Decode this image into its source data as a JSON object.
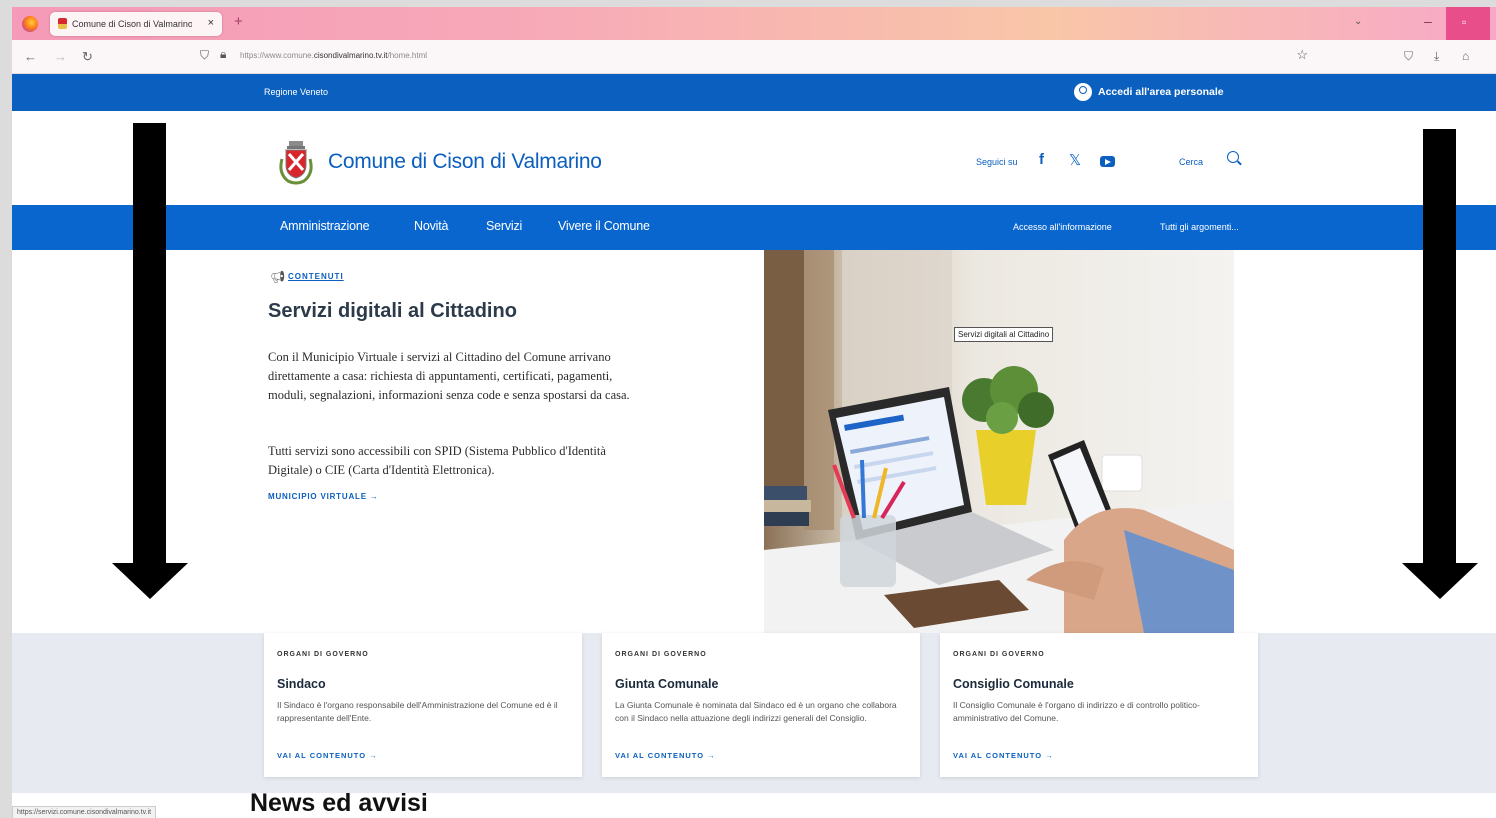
{
  "browser": {
    "tab_title": "Comune di Cison di Valmarino",
    "url_prefix": "https://www.comune.",
    "url_domain": "cisondivalmarino.tv.it",
    "url_path": "/home.html",
    "status_url": "https://servizi.comune.cisondivalmarino.tv.it"
  },
  "header": {
    "region": "Regione Veneto",
    "login": "Accedi all'area personale",
    "site_name": "Comune di Cison di Valmarino",
    "follow": "Seguici su",
    "search": "Cerca"
  },
  "nav": {
    "items": [
      "Amministrazione",
      "Novità",
      "Servizi",
      "Vivere il Comune"
    ],
    "secondary": [
      "Accesso all'informazione",
      "Tutti gli argomenti..."
    ]
  },
  "hero": {
    "category": "CONTENUTI",
    "title": "Servizi digitali al Cittadino",
    "p1": "Con il Municipio Virtuale i servizi al Cittadino del Comune arrivano direttamente a casa: richiesta di appuntamenti, certificati, pagamenti, moduli, segnalazioni, informazioni senza code e senza spostarsi da casa.",
    "p2": "Tutti servizi sono accessibili con SPID (Sistema Pubblico d'Identità Digitale) o CIE (Carta d'Identità Elettronica).",
    "link": "MUNICIPIO VIRTUALE  →",
    "image_tag": "Servizi digitali al Cittadino"
  },
  "cards": [
    {
      "kicker": "ORGANI DI GOVERNO",
      "title": "Sindaco",
      "desc": "Il Sindaco è l'organo responsabile dell'Amministrazione del Comune ed è il rappresentante dell'Ente.",
      "link": "VAI AL CONTENUTO  →"
    },
    {
      "kicker": "ORGANI DI GOVERNO",
      "title": "Giunta Comunale",
      "desc": "La Giunta Comunale è nominata dal Sindaco ed è un organo che collabora con il Sindaco nella attuazione degli indirizzi generali del Consiglio.",
      "link": "VAI AL CONTENUTO  →"
    },
    {
      "kicker": "ORGANI DI GOVERNO",
      "title": "Consiglio Comunale",
      "desc": "Il Consiglio Comunale è l'organo di indirizzo e di controllo politico-amministrativo del Comune.",
      "link": "VAI AL CONTENUTO  →"
    }
  ],
  "news_title": "News ed avvisi",
  "colors": {
    "primary": "#0a5fbf",
    "nav": "#0a66cf",
    "band": "#e7ebf1"
  }
}
